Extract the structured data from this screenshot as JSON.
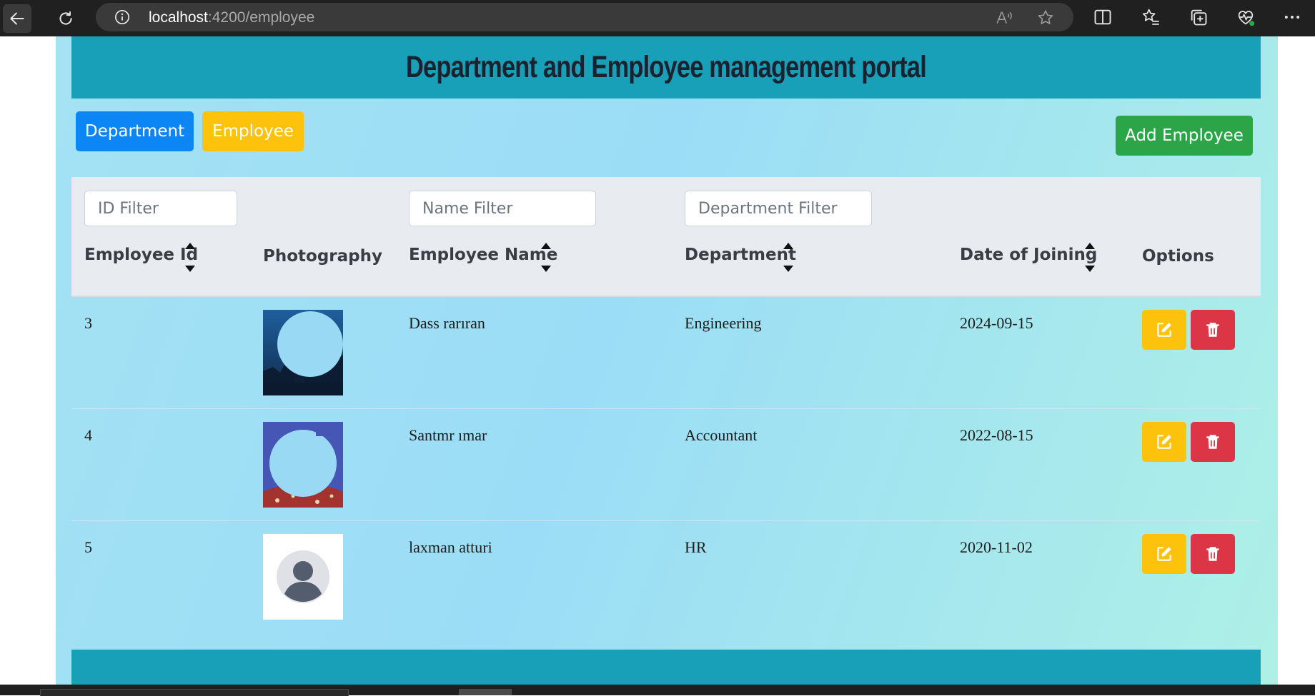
{
  "browser": {
    "url_host": "localhost",
    "url_path": ":4200/employee"
  },
  "header": {
    "title": "Department and Employee management portal"
  },
  "nav": {
    "department_label": "Department",
    "employee_label": "Employee",
    "add_employee_label": "Add Employee"
  },
  "filters": {
    "id_placeholder": "ID Filter",
    "name_placeholder": "Name Filter",
    "department_placeholder": "Department Filter"
  },
  "columns": {
    "id": "Employee Id",
    "photo": "Photography",
    "name": "Employee Name",
    "department": "Department",
    "doj": "Date of Joining",
    "options": "Options"
  },
  "rows": [
    {
      "id": "3",
      "name": "Dass     rarıran",
      "department": "Engineering",
      "doj": "2024-09-15",
      "photo": "night-scene-photo"
    },
    {
      "id": "4",
      "name": "Santmr     ımar",
      "department": "Accountant",
      "doj": "2022-08-15",
      "photo": "portrait-photo"
    },
    {
      "id": "5",
      "name": "laxman atturi",
      "department": "HR",
      "doj": "2020-11-02",
      "photo": "default-avatar"
    }
  ],
  "icons": {
    "edit": "pencil-square-icon",
    "delete": "trash-icon"
  },
  "colors": {
    "header_bg": "#18a0b8",
    "department_button": "#0d86f5",
    "employee_button": "#fcc20c",
    "add_button": "#2ba548",
    "edit_button": "#fcc20c",
    "delete_button": "#dc3545"
  }
}
